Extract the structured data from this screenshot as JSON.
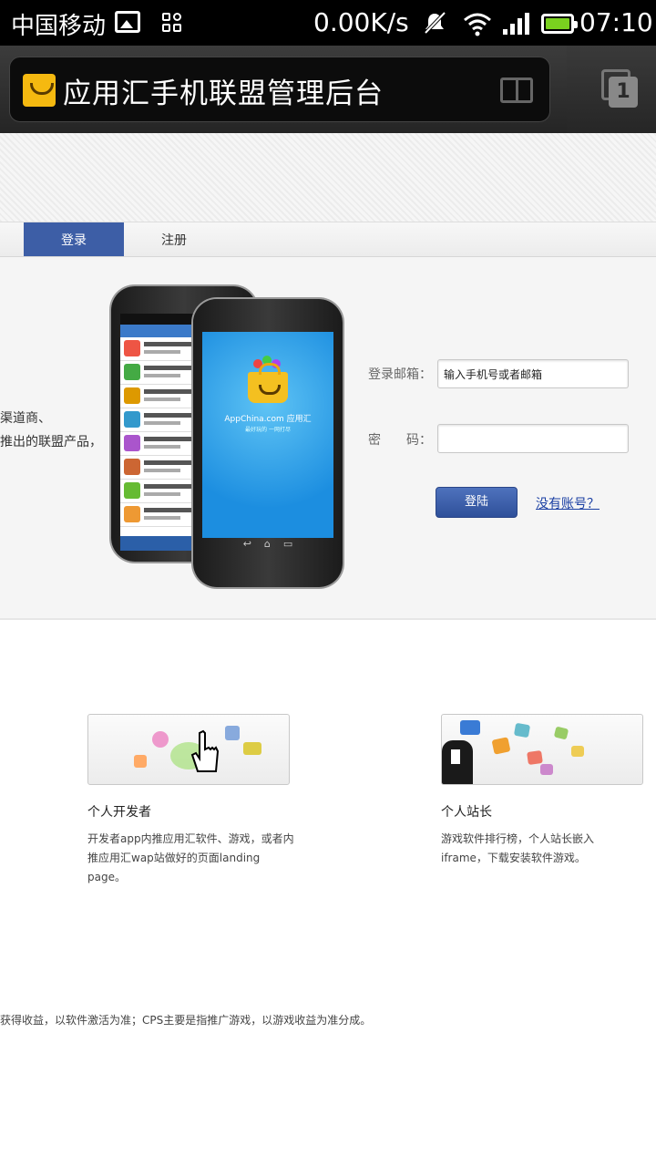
{
  "status_bar": {
    "carrier": "中国移动",
    "net_speed": "0.00K/s",
    "time": "07:10",
    "icons": [
      "image-icon",
      "grid-icon",
      "mute-icon",
      "wifi-icon",
      "signal-icon",
      "battery-icon"
    ],
    "battery_color": "#7ad11f"
  },
  "browser": {
    "page_title": "应用汇手机联盟管理后台",
    "tab_count": "1",
    "logo_color": "#f5b910"
  },
  "nav": {
    "tabs": [
      {
        "label": "登录",
        "active": true
      },
      {
        "label": "注册",
        "active": false
      }
    ],
    "active_color": "#3d5ea6"
  },
  "hero": {
    "text_lines": [
      "渠道商、",
      "推出的联盟产品，"
    ],
    "phone_screen": {
      "brand": "AppChina.com 应用汇",
      "tagline": "最好玩的 一网打尽"
    }
  },
  "login_form": {
    "email_label": "登录邮箱：",
    "email_placeholder": "输入手机号或者邮箱",
    "password_label": "密　　码：",
    "submit_label": "登陆",
    "no_account_link": "没有账号？"
  },
  "features": [
    {
      "title": "个人开发者",
      "desc": "开发者app内推应用汇软件、游戏，或者内推应用汇wap站做好的页面landing page。"
    },
    {
      "title": "个人站长",
      "desc": "游戏软件排行榜，个人站长嵌入iframe，下载安装软件游戏。"
    }
  ],
  "footer_note": "获得收益，以软件激活为准；CPS主要是指推广游戏，以游戏收益为准分成。"
}
